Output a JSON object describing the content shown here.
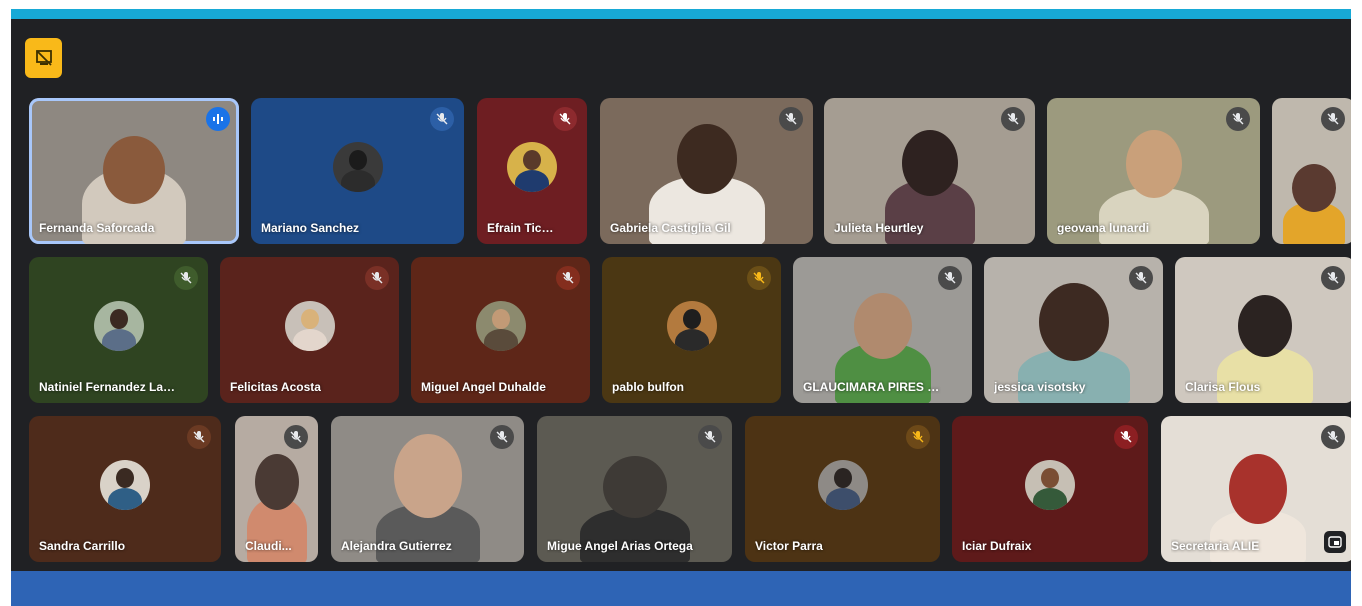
{
  "colors": {
    "topbar": "#17a9d6",
    "stage": "#202124",
    "bottombar": "#2e64b5",
    "badge": "#f9b919",
    "speaking_ring": "#a8c7fa"
  },
  "badge_icon": "no-video-icon",
  "participants": [
    {
      "name": "Fernanda Saforcada",
      "state": "speaking"
    },
    {
      "name": "Mariano Sanchez",
      "state": "muted"
    },
    {
      "name": "Efrain Ticona",
      "state": "muted"
    },
    {
      "name": "Gabriela Castiglia Gil",
      "state": "muted"
    },
    {
      "name": "Julieta Heurtley",
      "state": "muted"
    },
    {
      "name": "geovana lunardi",
      "state": "muted"
    },
    {
      "name": "",
      "state": "muted"
    },
    {
      "name": "Natiniel Fernandez Lag...",
      "state": "muted"
    },
    {
      "name": "Felicitas Acosta",
      "state": "muted"
    },
    {
      "name": "Miguel Angel Duhalde",
      "state": "muted"
    },
    {
      "name": "pablo bulfon",
      "state": "muted"
    },
    {
      "name": "GLAUCIMARA PIRES O...",
      "state": "muted"
    },
    {
      "name": "jessica visotsky",
      "state": "muted"
    },
    {
      "name": "Clarisa Flous",
      "state": "muted"
    },
    {
      "name": "Sandra Carrillo",
      "state": "muted"
    },
    {
      "name": "Claudi...",
      "state": "muted"
    },
    {
      "name": "Alejandra Gutierrez",
      "state": "muted"
    },
    {
      "name": "Migue Angel Arias Ortega",
      "state": "muted"
    },
    {
      "name": "Victor Parra",
      "state": "muted"
    },
    {
      "name": "Iciar Dufraix",
      "state": "muted"
    },
    {
      "name": "Secretaria ALIE",
      "state": "muted"
    }
  ]
}
